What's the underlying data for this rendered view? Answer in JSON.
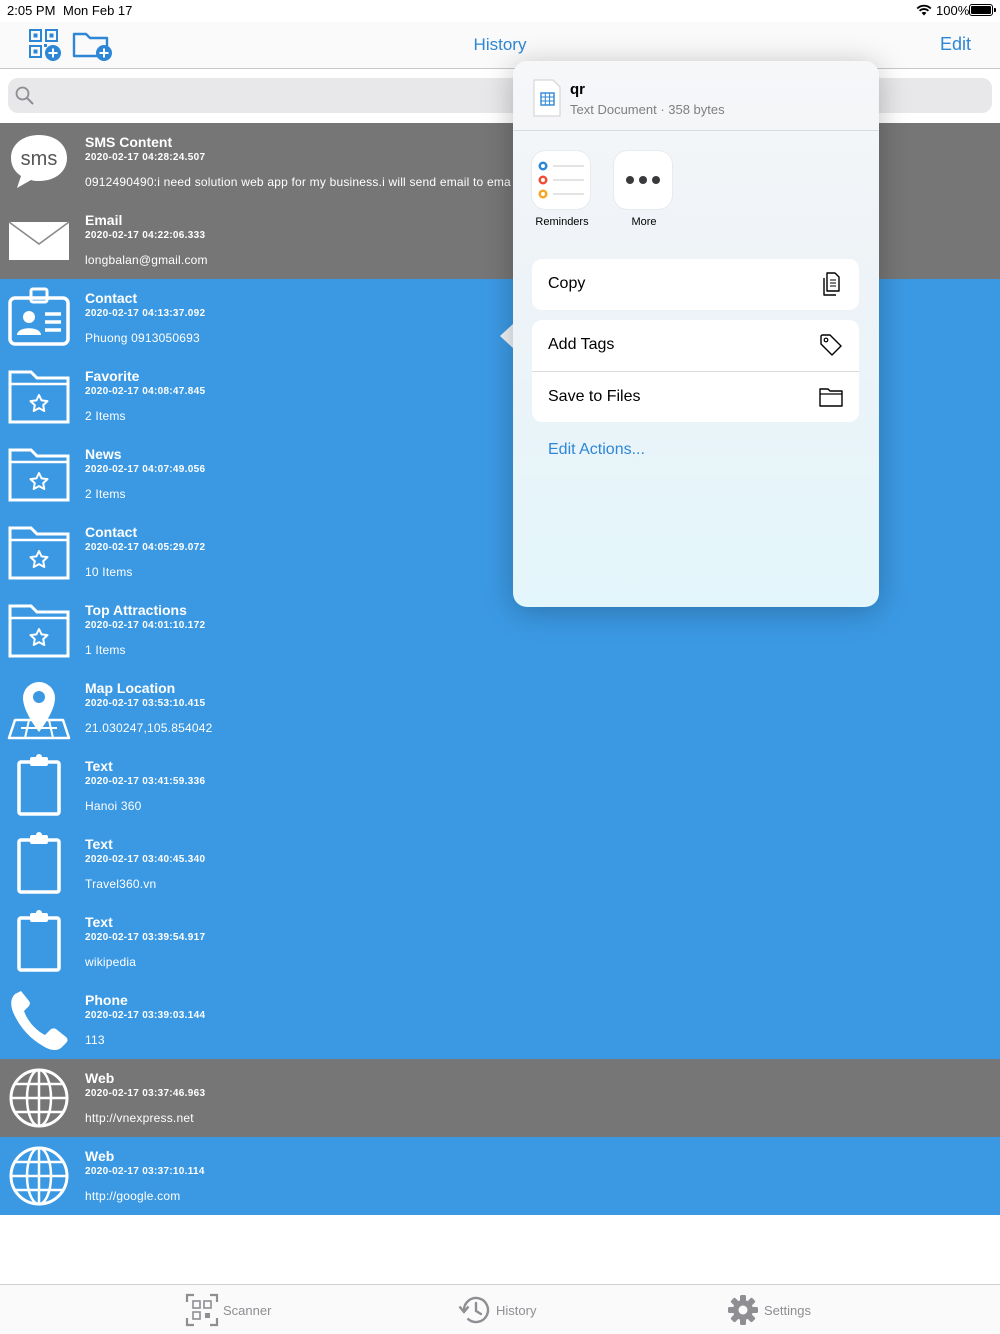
{
  "status_bar": {
    "time": "2:05 PM",
    "date": "Mon Feb 17",
    "battery": "100%"
  },
  "nav": {
    "title": "History",
    "edit": "Edit",
    "left_icons": [
      "qr-add-icon",
      "folder-add-icon"
    ]
  },
  "search": {
    "placeholder": "",
    "value": ""
  },
  "colors": {
    "accent": "#2d86d6",
    "row_blue": "#3b99e3",
    "row_gray": "#767676"
  },
  "history": [
    {
      "icon": "sms-icon",
      "title": "SMS Content",
      "date": "2020-02-17 04:28:24.507",
      "content": "0912490490:i need solution web app for my business.i will send email to ema",
      "style": "gray"
    },
    {
      "icon": "email-icon",
      "title": "Email",
      "date": "2020-02-17 04:22:06.333",
      "content": "longbalan@gmail.com",
      "style": "gray"
    },
    {
      "icon": "contact-card-icon",
      "title": "Contact",
      "date": "2020-02-17 04:13:37.092",
      "content": " Phuong 0913050693",
      "style": "blue"
    },
    {
      "icon": "folder-star-icon",
      "title": "Favorite",
      "date": "2020-02-17 04:08:47.845",
      "content": "2 Items",
      "style": "blue"
    },
    {
      "icon": "folder-star-icon",
      "title": "News",
      "date": "2020-02-17 04:07:49.056",
      "content": "2 Items",
      "style": "blue"
    },
    {
      "icon": "folder-star-icon",
      "title": "Contact",
      "date": "2020-02-17 04:05:29.072",
      "content": "10 Items",
      "style": "blue"
    },
    {
      "icon": "folder-star-icon",
      "title": "Top Attractions",
      "date": "2020-02-17 04:01:10.172",
      "content": "1 Items",
      "style": "blue"
    },
    {
      "icon": "map-pin-icon",
      "title": "Map Location",
      "date": "2020-02-17 03:53:10.415",
      "content": "21.030247,105.854042",
      "style": "blue"
    },
    {
      "icon": "clipboard-icon",
      "title": "Text",
      "date": "2020-02-17 03:41:59.336",
      "content": "Hanoi 360",
      "style": "blue"
    },
    {
      "icon": "clipboard-icon",
      "title": "Text",
      "date": "2020-02-17 03:40:45.340",
      "content": "Travel360.vn",
      "style": "blue"
    },
    {
      "icon": "clipboard-icon",
      "title": "Text",
      "date": "2020-02-17 03:39:54.917",
      "content": "wikipedia",
      "style": "blue"
    },
    {
      "icon": "phone-icon",
      "title": "Phone",
      "date": "2020-02-17 03:39:03.144",
      "content": "113",
      "style": "blue"
    },
    {
      "icon": "globe-icon",
      "title": "Web",
      "date": "2020-02-17 03:37:46.963",
      "content": "http://vnexpress.net",
      "style": "gray"
    },
    {
      "icon": "globe-icon",
      "title": "Web",
      "date": "2020-02-17 03:37:10.114",
      "content": "http://google.com",
      "style": "blue"
    }
  ],
  "share_sheet": {
    "file_name": "qr",
    "file_meta": "Text Document · 358 bytes",
    "apps": [
      {
        "label": "Reminders",
        "icon": "reminders-icon"
      },
      {
        "label": "More",
        "icon": "more-icon"
      }
    ],
    "actions_group1": [
      {
        "label": "Copy",
        "icon": "copy-icon"
      }
    ],
    "actions_group2": [
      {
        "label": "Add Tags",
        "icon": "tag-icon"
      },
      {
        "label": "Save to Files",
        "icon": "folder-icon"
      }
    ],
    "edit_actions": "Edit Actions..."
  },
  "tab_bar": {
    "tabs": [
      {
        "label": "Scanner",
        "icon": "scanner-icon"
      },
      {
        "label": "History",
        "icon": "history-icon"
      },
      {
        "label": "Settings",
        "icon": "settings-gear-icon"
      }
    ]
  }
}
